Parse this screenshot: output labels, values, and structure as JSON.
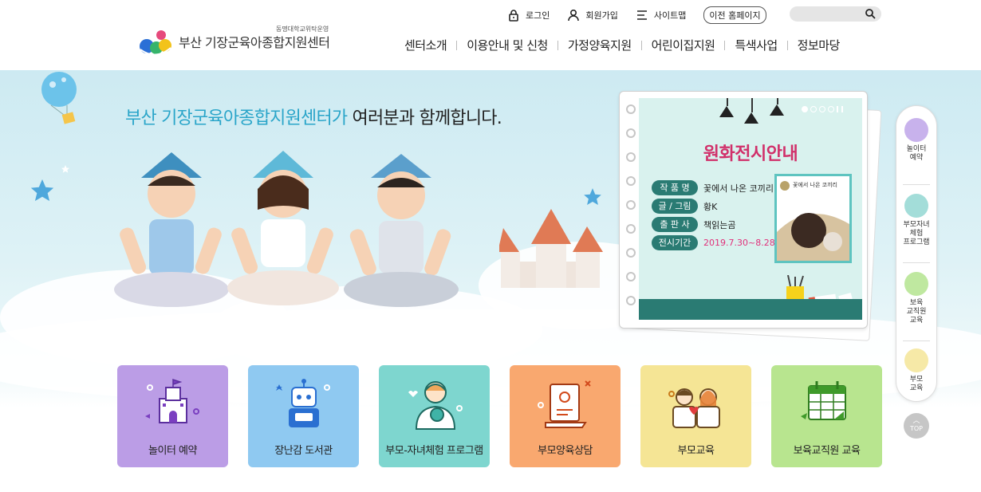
{
  "header": {
    "logo_sub": "동명대학교위탁운영",
    "logo_title": "부산 기장군육아종합지원센터",
    "util": [
      {
        "label": "로그인",
        "icon": "lock-icon"
      },
      {
        "label": "회원가입",
        "icon": "person-icon"
      },
      {
        "label": "사이트맵",
        "icon": "menu-icon"
      }
    ],
    "prev_home": "이전 홈페이지",
    "search": {
      "placeholder": "",
      "icon": "search-icon"
    },
    "gnb": [
      "센터소개",
      "이용안내 및 신청",
      "가정양육지원",
      "어린이집지원",
      "특색사업",
      "정보마당"
    ]
  },
  "hero": {
    "title_highlight": "부산 기장군육아종합지원센터가",
    "title_normal": " 여러분과 함께합니다."
  },
  "exhibition": {
    "title": "원화전시안내",
    "rows": [
      {
        "key": "작 품 명",
        "value": "꽃에서 나온 코끼리"
      },
      {
        "key": "글 / 그림",
        "value": "황K"
      },
      {
        "key": "출 판 사",
        "value": "책읽는곰"
      },
      {
        "key": "전시기간",
        "value": "2019.7.30~8.28"
      }
    ],
    "book_title": "꽃에서 나온 코끼리"
  },
  "quick_nav": [
    {
      "label": "놀이터\n예약",
      "icon": "castle-icon"
    },
    {
      "label": "부모자녀\n체험\n프로그램",
      "icon": "parent-child-icon"
    },
    {
      "label": "보육\n교직원\n교육",
      "icon": "calendar-icon"
    },
    {
      "label": "부모\n교육",
      "icon": "parents-icon"
    }
  ],
  "top_label": "TOP",
  "cards": [
    {
      "label": "놀이터 예약",
      "color": "#bb9de6",
      "icon": "castle-icon"
    },
    {
      "label": "장난감 도서관",
      "color": "#8fc9f1",
      "icon": "robot-icon"
    },
    {
      "label": "부모-자녀체험 프로그램",
      "color": "#7ed6cf",
      "icon": "mother-baby-icon"
    },
    {
      "label": "부모양육상담",
      "color": "#f9a86f",
      "icon": "document-icon"
    },
    {
      "label": "부모교육",
      "color": "#f5e595",
      "icon": "family-icon"
    },
    {
      "label": "보육교직원 교육",
      "color": "#b8e58f",
      "icon": "calendar-icon"
    }
  ]
}
